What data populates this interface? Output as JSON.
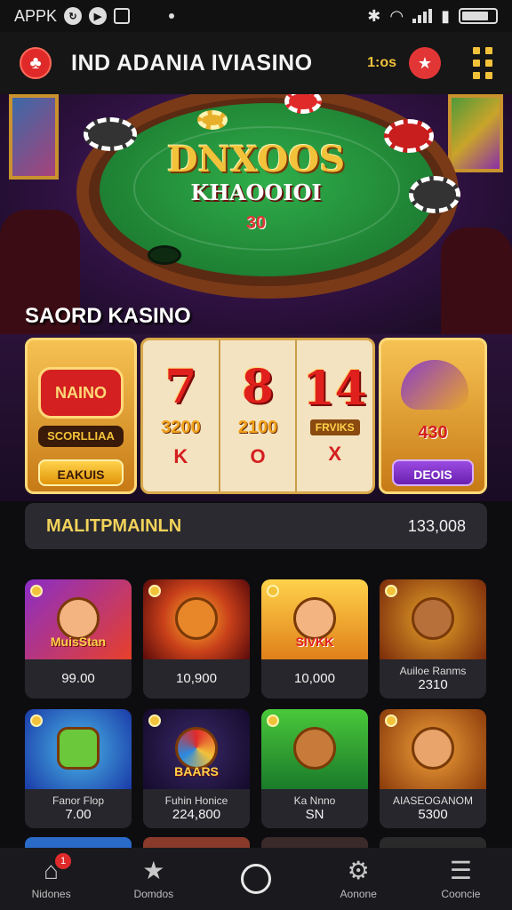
{
  "status_bar": {
    "app": "APPK"
  },
  "header": {
    "title": "IND ADANIA IVIASINO",
    "coins": "1:os",
    "logo": "♣",
    "gift": "★"
  },
  "hero": {
    "title": "DNXOOS",
    "subtitle": "KHAOOIOI",
    "amount": "30",
    "section_label": "SAORD KASINO"
  },
  "slots": {
    "left_card": {
      "logo": "NAINO",
      "sub": "SCORLLIAA",
      "button": "EAKUIS"
    },
    "reels": [
      {
        "num": "7",
        "amount": "3200",
        "symbol": "K"
      },
      {
        "num": "8",
        "amount": "2100",
        "symbol": "O"
      },
      {
        "num": "14",
        "amount": "FRVIKS",
        "symbol": "X"
      }
    ],
    "right_card": {
      "amount": "430",
      "button": "DEOIS"
    }
  },
  "info_bar": {
    "label": "MALITPMAINLN",
    "value": "133,008"
  },
  "games": [
    {
      "art_title": "MuisStan",
      "name": "",
      "value": "99.00"
    },
    {
      "art_title": "",
      "name": "",
      "value": "10,900"
    },
    {
      "art_title": "SIVKK",
      "name": "",
      "value": "10,000"
    },
    {
      "art_title": "",
      "name": "Auiloe Ranms",
      "value": "2310"
    },
    {
      "art_title": "",
      "name": "Fanor Flop",
      "value": "7.00"
    },
    {
      "art_title": "BAARS",
      "name": "Fuhin Honice",
      "value": "224,800"
    },
    {
      "art_title": "",
      "name": "Ka Nnno",
      "value": "SN"
    },
    {
      "art_title": "",
      "name": "AIASEOGANOM",
      "value": "5300"
    }
  ],
  "nav": [
    {
      "label": "Nidones",
      "icon": "⌂",
      "badge": "1"
    },
    {
      "label": "Domdos",
      "icon": "★"
    },
    {
      "label": "",
      "icon": ""
    },
    {
      "label": "Aonone",
      "icon": "⚙"
    },
    {
      "label": "Cooncie",
      "icon": "☰"
    }
  ],
  "colors": {
    "accent": "#f2c23a",
    "brand_red": "#e02a2a",
    "background": "#0d0d10"
  }
}
